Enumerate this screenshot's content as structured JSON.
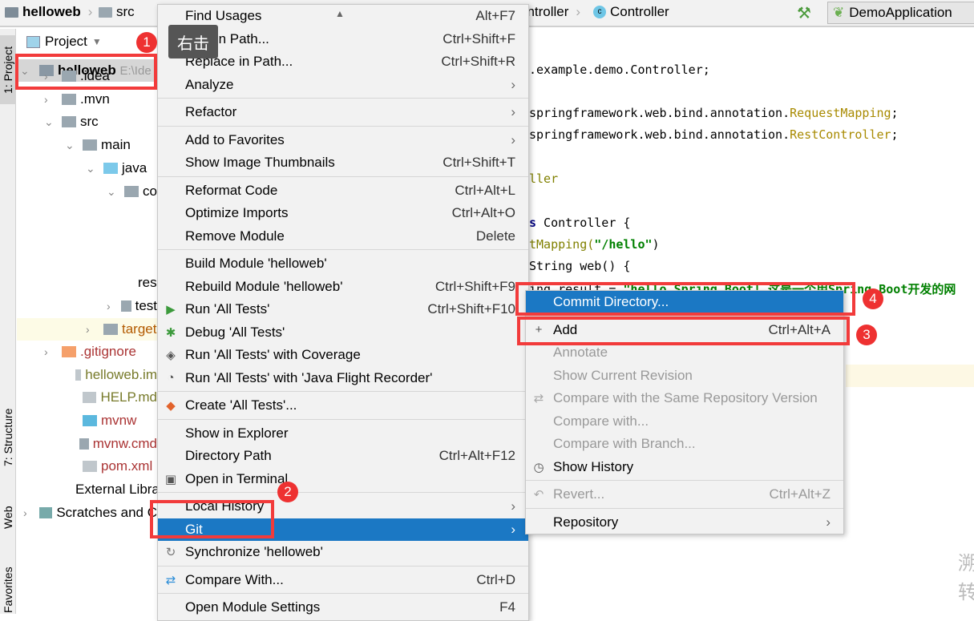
{
  "breadcrumb": [
    "helloweb",
    "src",
    "ontroller",
    "Controller"
  ],
  "toolbar": {
    "run_config": "DemoApplication",
    "build_icon": "hammer-icon"
  },
  "side_tabs": [
    "1: Project",
    "7: Structure",
    "Web",
    "Favorites"
  ],
  "project_panel": {
    "title": "Project",
    "root_label": "helloweb",
    "root_path": "E:\\Ide",
    "rows": [
      ".idea",
      ".mvn",
      "src",
      "main",
      "java",
      "co",
      "resou",
      "test",
      "target",
      ".gitignore",
      "helloweb.im",
      "HELP.md",
      "mvnw",
      "mvnw.cmd",
      "pom.xml",
      "External Librar",
      "Scratches and C"
    ]
  },
  "code": {
    "line1": ".example.demo.Controller;",
    "line2a": "springframework.web.bind.annotation.",
    "line2b": "RequestMapping",
    ";": ";",
    "line3a": "springframework.web.bind.annotation.",
    "line3b": "RestController",
    "line4": "ller",
    "line5a": "s",
    "line5b": " Controller {",
    "line6a": "tMapping(",
    "line6b": "\"/hello\"",
    "line6c": ")",
    "line7": "String web() {",
    "line8a": "ing result = ",
    "line8b": "\"hello Spring Boot! 这是一个用Spring Boot开发的网"
  },
  "context_menu": {
    "items": [
      {
        "label": "Find Usages",
        "shortcut": "Alt+F7"
      },
      {
        "label": "Find in Path...",
        "shortcut": "Ctrl+Shift+F"
      },
      {
        "label": "Replace in Path...",
        "shortcut": "Ctrl+Shift+R"
      },
      {
        "label": "Analyze",
        "submenu": true,
        "sep": true
      },
      {
        "label": "Refactor",
        "submenu": true,
        "sep": true
      },
      {
        "label": "Add to Favorites",
        "submenu": true
      },
      {
        "label": "Show Image Thumbnails",
        "shortcut": "Ctrl+Shift+T",
        "sep": true
      },
      {
        "label": "Reformat Code",
        "shortcut": "Ctrl+Alt+L"
      },
      {
        "label": "Optimize Imports",
        "shortcut": "Ctrl+Alt+O"
      },
      {
        "label": "Remove Module",
        "shortcut": "Delete",
        "sep": true
      },
      {
        "label": "Build Module 'helloweb'"
      },
      {
        "label": "Rebuild Module 'helloweb'",
        "shortcut": "Ctrl+Shift+F9"
      },
      {
        "label": "Run 'All Tests'",
        "shortcut": "Ctrl+Shift+F10",
        "icon": "▶",
        "icon_name": "run-icon",
        "color": "#3c9a3c"
      },
      {
        "label": "Debug 'All Tests'",
        "icon": "✱",
        "icon_name": "debug-icon",
        "color": "#3c9a3c"
      },
      {
        "label": "Run 'All Tests' with Coverage",
        "icon": "◈",
        "icon_name": "coverage-icon",
        "color": "#555"
      },
      {
        "label": "Run 'All Tests' with 'Java Flight Recorder'",
        "icon": "◔",
        "icon_name": "profiler-icon",
        "color": "#555",
        "sep": true
      },
      {
        "label": "Create 'All Tests'...",
        "icon": "◆",
        "icon_name": "create-config-icon",
        "color": "#e2632c",
        "sep": true
      },
      {
        "label": "Show in Explorer"
      },
      {
        "label": "Directory Path",
        "shortcut": "Ctrl+Alt+F12"
      },
      {
        "label": "Open in Terminal",
        "icon": "▣",
        "icon_name": "terminal-icon",
        "color": "#555",
        "sep": true
      },
      {
        "label": "Local History",
        "submenu": true
      },
      {
        "label": "Git",
        "submenu": true,
        "highlight": true
      },
      {
        "label": "Synchronize 'helloweb'",
        "icon": "↻",
        "icon_name": "sync-icon",
        "color": "#777",
        "sep": true
      },
      {
        "label": "Compare With...",
        "shortcut": "Ctrl+D",
        "icon": "⇄",
        "icon_name": "compare-icon",
        "color": "#2f8fd8",
        "sep": true
      },
      {
        "label": "Open Module Settings",
        "shortcut": "F4"
      }
    ]
  },
  "git_menu": {
    "items": [
      {
        "label": "Commit Directory...",
        "highlight": true,
        "sep": true
      },
      {
        "label": "Add",
        "shortcut": "Ctrl+Alt+A",
        "icon": "+",
        "icon_name": "plus-icon"
      },
      {
        "label": "Annotate",
        "disabled": true
      },
      {
        "label": "Show Current Revision",
        "disabled": true
      },
      {
        "label": "Compare with the Same Repository Version",
        "disabled": true,
        "icon": "⇄",
        "icon_name": "compare-icon"
      },
      {
        "label": "Compare with...",
        "disabled": true
      },
      {
        "label": "Compare with Branch...",
        "disabled": true
      },
      {
        "label": "Show History",
        "icon": "◷",
        "icon_name": "history-icon",
        "sep": true
      },
      {
        "label": "Revert...",
        "shortcut": "Ctrl+Alt+Z",
        "disabled": true,
        "icon": "↶",
        "icon_name": "revert-icon",
        "sep": true
      },
      {
        "label": "Repository",
        "submenu": true
      }
    ]
  },
  "annotations": {
    "tooltip": "右击",
    "steps": [
      "1",
      "2",
      "3",
      "4"
    ],
    "accent": "#f23b3b"
  },
  "watermark": [
    "溯",
    "转"
  ],
  "colors": {
    "selection": "#1b78c4",
    "menu_bg": "#f2f2f2"
  }
}
